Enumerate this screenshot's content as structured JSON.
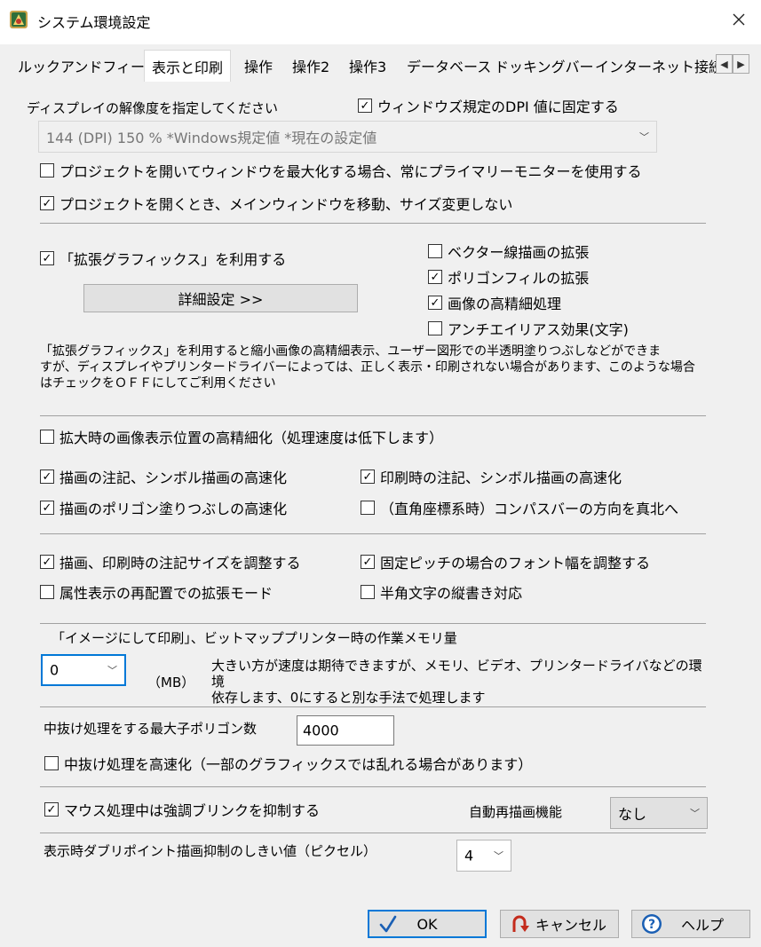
{
  "window": {
    "title": "システム環境設定"
  },
  "tabs": [
    "ルックアンドフィール",
    "表示と印刷",
    "操作",
    "操作2",
    "操作3",
    "データベース",
    "ドッキングバー",
    "インターネット接続"
  ],
  "dpi": {
    "label": "ディスプレイの解像度を指定してください",
    "fix_label": "ウィンドウズ規定のDPI 値に固定する",
    "fix_checked": true,
    "select_value": "144 (DPI)  150 % *Windows規定値 *現在の設定値"
  },
  "checks1": [
    {
      "label": "プロジェクトを開いてウィンドウを最大化する場合、常にプライマリーモニターを使用する",
      "checked": false
    },
    {
      "label": "プロジェクトを開くとき、メインウィンドウを移動、サイズ変更しない",
      "checked": true
    }
  ],
  "graphics": {
    "enable_label": "「拡張グラフィックス」を利用する",
    "enable_checked": true,
    "detail_button": "詳細設定 >>",
    "options": [
      {
        "label": "ベクター線描画の拡張",
        "checked": false
      },
      {
        "label": "ポリゴンフィルの拡張",
        "checked": true
      },
      {
        "label": "画像の高精細処理",
        "checked": true
      },
      {
        "label": "アンチエイリアス効果(文字)",
        "checked": false
      }
    ],
    "note_lines": [
      "「拡張グラフィックス」を利用すると縮小画像の高精細表示、ユーザー図形での半透明塗りつぶしなどができま",
      "すが、ディスプレイやプリンタードライバーによっては、正しく表示・印刷されない場合があります、このような場合",
      "はチェックをＯＦＦにしてご利用ください"
    ]
  },
  "render": {
    "hires": {
      "label": "拡大時の画像表示位置の高精細化（処理速度は低下します）",
      "checked": false
    },
    "left": [
      {
        "label": "描画の注記、シンボル描画の高速化",
        "checked": true
      },
      {
        "label": "描画のポリゴン塗りつぶしの高速化",
        "checked": true
      }
    ],
    "right": [
      {
        "label": "印刷時の注記、シンボル描画の高速化",
        "checked": true
      },
      {
        "label": "（直角座標系時）コンパスバーの方向を真北へ",
        "checked": false
      }
    ]
  },
  "annotation": {
    "left": [
      {
        "label": "描画、印刷時の注記サイズを調整する",
        "checked": true
      },
      {
        "label": "属性表示の再配置での拡張モード",
        "checked": false
      }
    ],
    "right": [
      {
        "label": "固定ピッチの場合のフォント幅を調整する",
        "checked": true
      },
      {
        "label": "半角文字の縦書き対応",
        "checked": false
      }
    ]
  },
  "memory": {
    "label": "「イメージにして印刷」、ビットマッププリンター時の作業メモリ量",
    "value": "0",
    "unit": "（MB）",
    "note_lines": [
      "大きい方が速度は期待できますが、メモリ、ビデオ、プリンタードライバなどの環境",
      "依存します、0にすると別な手法で処理します"
    ]
  },
  "polygon": {
    "label": "中抜け処理をする最大子ポリゴン数",
    "value": "4000",
    "fast_label": "中抜け処理を高速化（一部のグラフィックスでは乱れる場合があります）",
    "fast_checked": false
  },
  "mouse": {
    "label": "マウス処理中は強調ブリンクを抑制する",
    "checked": true,
    "redraw_label": "自動再描画機能",
    "redraw_value": "なし"
  },
  "threshold": {
    "label": "表示時ダブリポイント描画抑制のしきい値（ピクセル）",
    "value": "4"
  },
  "buttons": {
    "ok": "OK",
    "cancel": "キャンセル",
    "help": "ヘルプ"
  },
  "colors": {
    "accent": "#0078d7",
    "cancel_icon": "#c42b1c",
    "help_icon": "#1a5fb4"
  }
}
